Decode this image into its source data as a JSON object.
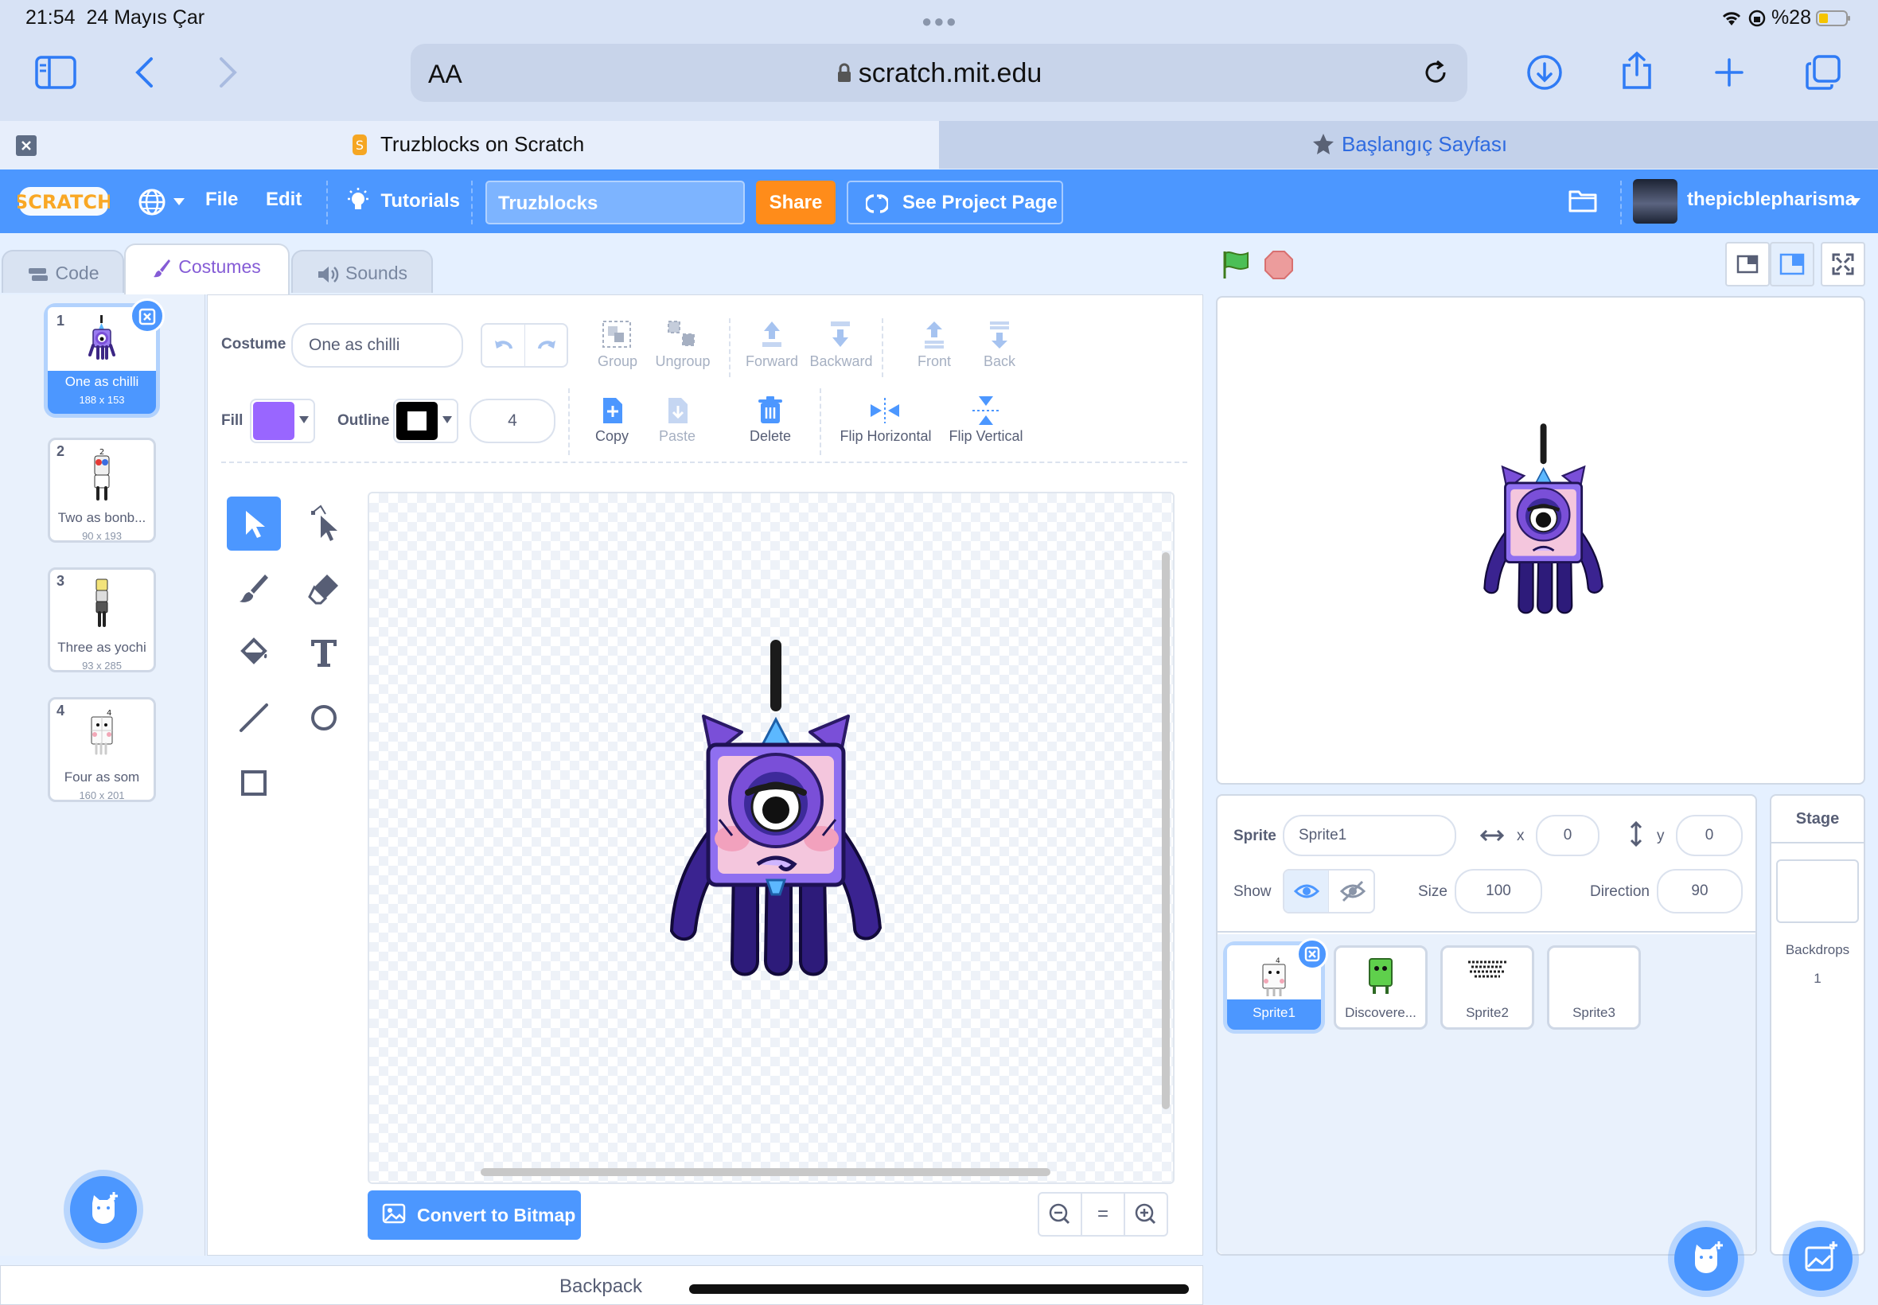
{
  "status": {
    "time": "21:54",
    "date": "24 Mayıs Çar",
    "battery": "%28"
  },
  "browser": {
    "aa": "AA",
    "url": "scratch.mit.edu",
    "tabs": [
      {
        "title": "Truzblocks on Scratch",
        "active": true
      },
      {
        "title": "Başlangıç Sayfası",
        "active": false
      }
    ]
  },
  "menubar": {
    "logo": "SCRATCH",
    "file": "File",
    "edit": "Edit",
    "tutorials": "Tutorials",
    "project_title": "Truzblocks",
    "share": "Share",
    "see_project": "See Project Page",
    "username": "thepicblepharisma"
  },
  "editor_tabs": {
    "code": "Code",
    "costumes": "Costumes",
    "sounds": "Sounds"
  },
  "costumes": [
    {
      "num": "1",
      "name": "One as chilli",
      "size": "188 x 153",
      "selected": true
    },
    {
      "num": "2",
      "name": "Two as bonb...",
      "size": "90 x 193",
      "selected": false
    },
    {
      "num": "3",
      "name": "Three as yochi",
      "size": "93 x 285",
      "selected": false
    },
    {
      "num": "4",
      "name": "Four as som",
      "size": "160 x 201",
      "selected": false
    }
  ],
  "paint": {
    "costume_label": "Costume",
    "costume_name": "One as chilli",
    "group": "Group",
    "ungroup": "Ungroup",
    "forward": "Forward",
    "backward": "Backward",
    "front": "Front",
    "back": "Back",
    "fill_label": "Fill",
    "fill_color": "#9966ff",
    "outline_label": "Outline",
    "outline_color": "#000000",
    "outline_width": "4",
    "copy": "Copy",
    "paste": "Paste",
    "delete": "Delete",
    "flip_h": "Flip Horizontal",
    "flip_v": "Flip Vertical",
    "convert": "Convert to Bitmap",
    "zoom_reset": "="
  },
  "sprite": {
    "label": "Sprite",
    "name": "Sprite1",
    "x_label": "x",
    "x": "0",
    "y_label": "y",
    "y": "0",
    "show_label": "Show",
    "size_label": "Size",
    "size": "100",
    "direction_label": "Direction",
    "direction": "90"
  },
  "sprites": [
    {
      "name": "Sprite1",
      "selected": true
    },
    {
      "name": "Discovere...",
      "selected": false
    },
    {
      "name": "Sprite2",
      "selected": false
    },
    {
      "name": "Sprite3",
      "selected": false
    }
  ],
  "stage_panel": {
    "title": "Stage",
    "backdrops_label": "Backdrops",
    "backdrops_count": "1"
  },
  "backpack": "Backpack",
  "colors": {
    "scratch_blue": "#4c97ff",
    "share_orange": "#ff8c1a",
    "costume_purple": "#855cd6"
  }
}
